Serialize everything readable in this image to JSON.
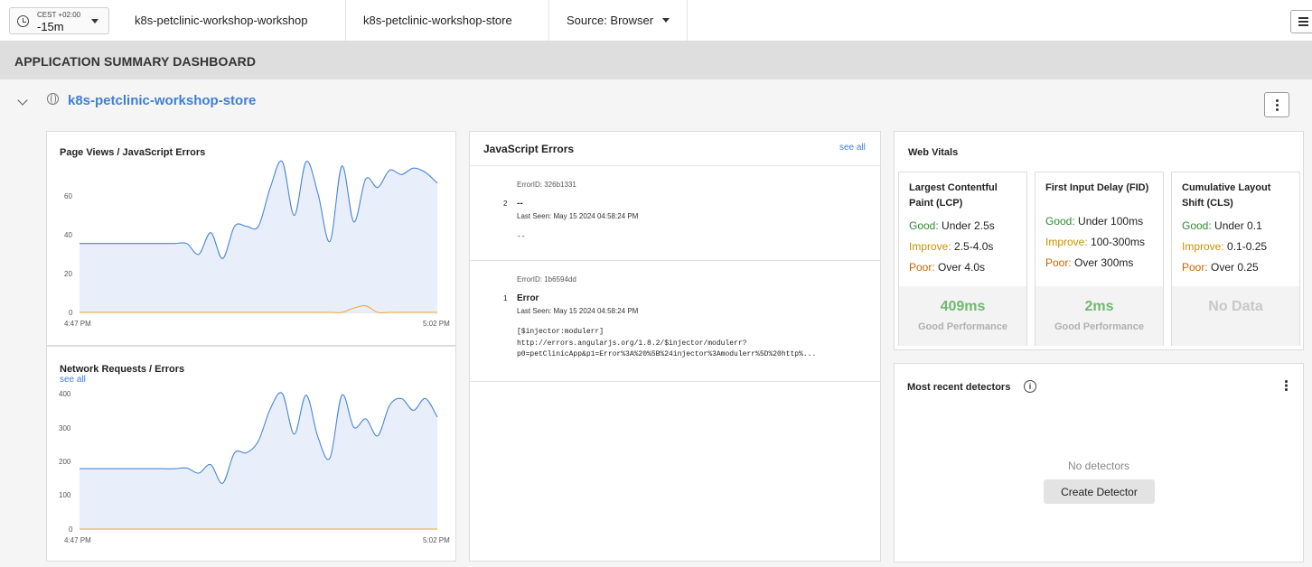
{
  "topbar": {
    "timezone": "CEST +02:00",
    "time_range": "-15m",
    "crumbs": [
      "k8s-petclinic-workshop-workshop",
      "k8s-petclinic-workshop-store",
      "Source: Browser"
    ]
  },
  "section": {
    "title": "APPLICATION SUMMARY DASHBOARD"
  },
  "app": {
    "name": "k8s-petclinic-workshop-store"
  },
  "page_views_chart": {
    "title": "Page Views / JavaScript Errors",
    "yticks": [
      "60",
      "40",
      "20",
      "0"
    ],
    "xticks": [
      "4:47 PM",
      "5:02 PM"
    ]
  },
  "network_chart": {
    "title": "Network Requests / Errors",
    "see_all": "see all",
    "yticks": [
      "400",
      "300",
      "200",
      "100",
      "0"
    ],
    "xticks": [
      "4:47 PM",
      "5:02 PM"
    ]
  },
  "chart_data": [
    {
      "type": "area",
      "title": "Page Views / JavaScript Errors",
      "x": [
        "4:47 PM",
        "",
        "",
        "",
        "",
        "",
        "",
        "",
        "",
        "",
        "",
        "",
        "",
        "",
        "",
        "",
        "",
        "",
        "",
        "",
        "",
        "",
        "",
        "",
        "",
        "",
        "",
        "",
        "",
        "",
        "5:02 PM"
      ],
      "ylim": [
        0,
        70
      ],
      "series": [
        {
          "values": [
            32,
            32,
            32,
            32,
            32,
            32,
            32,
            32,
            32,
            32,
            27,
            37,
            25,
            40,
            40,
            40,
            58,
            70,
            45,
            70,
            55,
            33,
            68,
            42,
            62,
            58,
            66,
            64,
            67,
            65,
            60
          ]
        },
        {
          "values": [
            0,
            0,
            0,
            0,
            0,
            0,
            0,
            0,
            0,
            0,
            0,
            0,
            0,
            0,
            0,
            0,
            0,
            0,
            0,
            0,
            0,
            0,
            0,
            2,
            3,
            0,
            0,
            0,
            0,
            0,
            0
          ]
        }
      ]
    },
    {
      "type": "area",
      "title": "Network Requests / Errors",
      "x": [
        "4:47 PM",
        "",
        "",
        "",
        "",
        "",
        "",
        "",
        "",
        "",
        "",
        "",
        "",
        "",
        "",
        "",
        "",
        "",
        "",
        "",
        "",
        "",
        "",
        "",
        "",
        "",
        "",
        "",
        "",
        "",
        "5:02 PM"
      ],
      "ylim": [
        0,
        410
      ],
      "series": [
        {
          "values": [
            178,
            178,
            178,
            178,
            178,
            178,
            178,
            178,
            178,
            180,
            165,
            190,
            135,
            225,
            225,
            260,
            355,
            400,
            280,
            395,
            270,
            210,
            395,
            300,
            325,
            275,
            365,
            385,
            350,
            385,
            330
          ]
        },
        {
          "values": [
            0,
            0,
            0,
            0,
            0,
            0,
            0,
            0,
            0,
            0,
            0,
            0,
            0,
            0,
            0,
            0,
            0,
            0,
            0,
            0,
            0,
            0,
            0,
            0,
            0,
            0,
            0,
            0,
            0,
            0,
            0
          ]
        }
      ]
    }
  ],
  "js_errors": {
    "title": "JavaScript Errors",
    "see_all": "see all",
    "items": [
      {
        "id": "ErrorID: 326b1331",
        "count": "2",
        "name": "--",
        "last_seen": "Last Seen: May 15 2024 04:58:24 PM",
        "message": "--"
      },
      {
        "id": "ErrorID: 1b6594dd",
        "count": "1",
        "name": "Error",
        "last_seen": "Last Seen: May 15 2024 04:58:24 PM",
        "message": "[$injector:modulerr]\nhttp://errors.angularjs.org/1.8.2/$injector/modulerr?\np0=petClinicApp&p1=Error%3A%20%5B%24injector%3Amodulerr%5D%20http%..."
      }
    ]
  },
  "web_vitals": {
    "title": "Web Vitals",
    "cards": [
      {
        "title": "Largest Contentful Paint (LCP)",
        "good_label": "Good:",
        "good": " Under 2.5s",
        "improve_label": "Improve:",
        "improve": " 2.5-4.0s",
        "poor_label": "Poor:",
        "poor": " Over 4.0s",
        "value": "409ms",
        "status": "Good Performance"
      },
      {
        "title": "First Input Delay (FID)",
        "good_label": "Good:",
        "good": " Under 100ms",
        "improve_label": "Improve:",
        "improve": " 100-300ms",
        "poor_label": "Poor:",
        "poor": " Over 300ms",
        "value": "2ms",
        "status": "Good Performance"
      },
      {
        "title": "Cumulative Layout Shift (CLS)",
        "good_label": "Good:",
        "good": " Under 0.1",
        "improve_label": "Improve:",
        "improve": " 0.1-0.25",
        "poor_label": "Poor:",
        "poor": " Over 0.25",
        "value": "No Data",
        "status": ""
      }
    ]
  },
  "detectors": {
    "title": "Most recent detectors",
    "info_glyph": "i",
    "empty_text": "No detectors",
    "create_label": "Create Detector"
  },
  "colors": {
    "series_primary": "#4a86d8",
    "series_fill": "#e8eefa",
    "series_errors": "#f0a030"
  }
}
